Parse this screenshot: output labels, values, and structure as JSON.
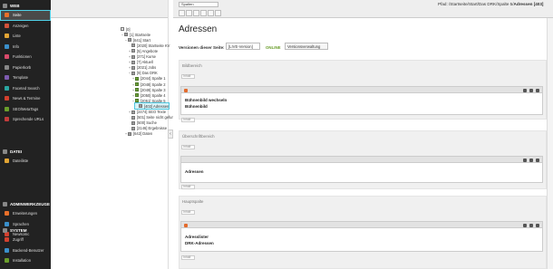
{
  "modules": {
    "groups": [
      {
        "label": "WEB",
        "items": [
          {
            "label": "Seite",
            "color": "#e8702a",
            "active": true
          },
          {
            "label": "Anzeigen",
            "color": "#d25139"
          },
          {
            "label": "Liste",
            "color": "#e2a534"
          },
          {
            "label": "Info",
            "color": "#3a8fca"
          },
          {
            "label": "Funktionen",
            "color": "#d94a6b"
          },
          {
            "label": "Papierkorb",
            "color": "#888888"
          },
          {
            "label": "Template",
            "color": "#7e5bb0"
          },
          {
            "label": "Faceted Search",
            "color": "#2aa6a0"
          },
          {
            "label": "News & Termine",
            "color": "#d2402e"
          },
          {
            "label": "SEO/MetaTags",
            "color": "#6a9e2b"
          },
          {
            "label": "Sprechende URLs",
            "color": "#c23b3b"
          }
        ]
      },
      {
        "label": "DATEI",
        "items": [
          {
            "label": "Dateiliste",
            "color": "#e2a534"
          }
        ]
      },
      {
        "label": "ADMINWERKZEUGE",
        "items": [
          {
            "label": "Erweiterungen",
            "color": "#e8702a"
          },
          {
            "label": "Sprachen",
            "color": "#3a8fca"
          },
          {
            "label": "Newsomc",
            "color": "#d2402e"
          }
        ]
      },
      {
        "label": "SYSTEM",
        "items": [
          {
            "label": "Zugriff",
            "color": "#d2402e"
          },
          {
            "label": "Backend-Benutzer",
            "color": "#3a8fca"
          },
          {
            "label": "Installation",
            "color": "#6a9e2b"
          }
        ]
      }
    ]
  },
  "tree": {
    "nodes": [
      {
        "label": "[0]",
        "exp": "",
        "icon": "w",
        "depth": 0
      },
      {
        "label": "[1] Startseite",
        "exp": "−",
        "icon": "gray",
        "depth": 1
      },
      {
        "label": "[641] Start",
        "exp": "−",
        "icon": "gray",
        "depth": 2
      },
      {
        "label": "[2020] Startseite KV",
        "exp": "",
        "icon": "gray",
        "depth": 3
      },
      {
        "label": "[5] Angebote",
        "exp": "+",
        "icon": "gray",
        "depth": 3
      },
      {
        "label": "[271] Kurse",
        "exp": "+",
        "icon": "gray",
        "depth": 3
      },
      {
        "label": "[7] Aktuell",
        "exp": "+",
        "icon": "gray",
        "depth": 3
      },
      {
        "label": "[2021] Jobs",
        "exp": "+",
        "icon": "gray",
        "depth": 3
      },
      {
        "label": "[9] Das DRK",
        "exp": "−",
        "icon": "gray",
        "depth": 3
      },
      {
        "label": "[2044] Spalte 1",
        "exp": "+",
        "icon": "g",
        "depth": 4
      },
      {
        "label": "[2048] Spalte 2",
        "exp": "+",
        "icon": "g",
        "depth": 4
      },
      {
        "label": "[2049] Spalte 3",
        "exp": "+",
        "icon": "g",
        "depth": 4
      },
      {
        "label": "[2050] Spalte 4",
        "exp": "+",
        "icon": "g",
        "depth": 4
      },
      {
        "label": "[2051] Spalte 5",
        "exp": "−",
        "icon": "g",
        "depth": 4
      },
      {
        "label": "[402] Adressen",
        "exp": "",
        "icon": "gray",
        "depth": 5,
        "selected": true
      },
      {
        "label": "[2474] SEO Texte",
        "exp": "+",
        "icon": "gray",
        "depth": 3
      },
      {
        "label": "[501] Seite nicht gefunden",
        "exp": "",
        "icon": "gray",
        "depth": 3
      },
      {
        "label": "[500] Suche",
        "exp": "",
        "icon": "gray",
        "depth": 3
      },
      {
        "label": "[2146] Ergebnisse",
        "exp": "",
        "icon": "gray",
        "depth": 3
      },
      {
        "label": "[642] Daten",
        "exp": "+",
        "icon": "gray",
        "depth": 2
      }
    ]
  },
  "header": {
    "select_value": "Spalten",
    "path_prefix": "Pfad: /Startseite/Start/Das DRK/Spalte 5/",
    "page_label": "Adressen [403]"
  },
  "page": {
    "title": "Adressen",
    "version_label": "Versionen dieser Seite:",
    "version_value": "[LIVE-Version]",
    "online": "ONLINE",
    "version_button": "Versionsverwaltung",
    "new_label": "Inhalt"
  },
  "columns": [
    {
      "label": "Bildbereich",
      "elements": [
        {
          "line1": "Bühnenbild wechseln",
          "line2": "Bühnenbild"
        }
      ]
    },
    {
      "label": "Überschriftbereich",
      "elements": [
        {
          "line1": "Adressen",
          "line2": ""
        }
      ]
    },
    {
      "label": "Hauptspalte",
      "elements": [
        {
          "line1": "Adresslister",
          "line2": "DRK-Adressen"
        }
      ]
    }
  ]
}
